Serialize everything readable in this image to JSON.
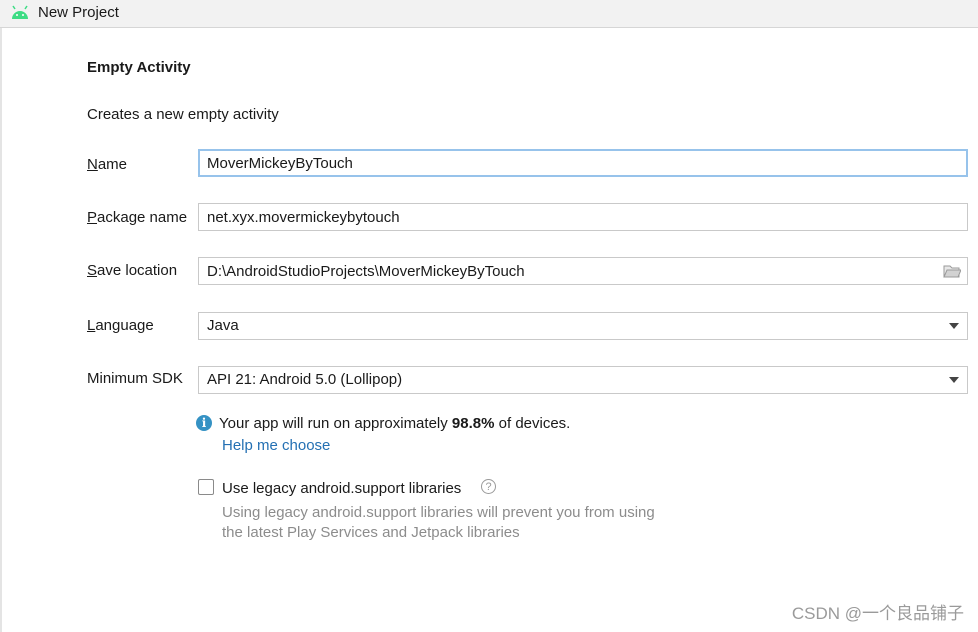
{
  "window": {
    "title": "New Project"
  },
  "form": {
    "heading": "Empty Activity",
    "description": "Creates a new empty activity",
    "name": {
      "label_key": "N",
      "label_rest": "ame",
      "value": "MoverMickeyByTouch"
    },
    "package": {
      "label_key": "P",
      "label_rest": "ackage name",
      "value": "net.xyx.movermickeybytouch"
    },
    "save_location": {
      "label_key": "S",
      "label_rest": "ave location",
      "value": "D:\\AndroidStudioProjects\\MoverMickeyByTouch"
    },
    "language": {
      "label_key": "L",
      "label_rest": "anguage",
      "value": "Java"
    },
    "min_sdk": {
      "label": "Minimum SDK",
      "value": "API 21: Android 5.0 (Lollipop)"
    }
  },
  "info": {
    "prefix": "Your app will run on approximately ",
    "percent": "98.8%",
    "suffix": " of devices.",
    "help_link": "Help me choose"
  },
  "legacy": {
    "checked": false,
    "label": "Use legacy android.support libraries",
    "hint_line1": "Using legacy android.support libraries will prevent you from using",
    "hint_line2": "the latest Play Services and Jetpack libraries"
  },
  "watermark": "CSDN @一个良品铺子",
  "icons": {
    "app": "android-icon",
    "folder": "folder-icon",
    "info": "info-icon",
    "help": "question-icon",
    "dropdown": "chevron-down-icon"
  },
  "colors": {
    "accent": "#3592c4",
    "link": "#2470b3",
    "android": "#3ddc84",
    "focus": "#97c3eb"
  }
}
